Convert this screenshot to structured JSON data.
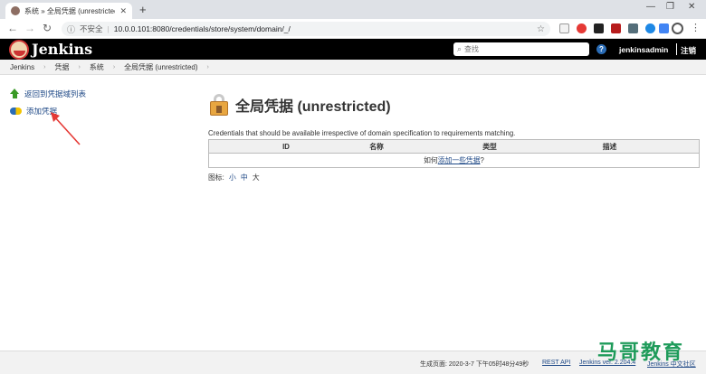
{
  "browser": {
    "tab_title": "系统 » 全局凭据 (unrestricted) [",
    "url_insecure": "不安全",
    "url": "10.0.0.101:8080/credentials/store/system/domain/_/"
  },
  "header": {
    "app_name": "Jenkins",
    "search_placeholder": "查找",
    "help": "?",
    "user": "jenkinsadmin",
    "logout": "注销"
  },
  "breadcrumb": [
    "Jenkins",
    "凭据",
    "系统",
    "全局凭据 (unrestricted)"
  ],
  "sidebar": {
    "items": [
      {
        "label": "返回到凭据域列表",
        "icon": "up-arrow-icon"
      },
      {
        "label": "添加凭据",
        "icon": "credentials-icon"
      }
    ]
  },
  "main": {
    "title": "全局凭据 (unrestricted)",
    "description": "Credentials that should be available irrespective of domain specification to requirements matching.",
    "table": {
      "columns": [
        "ID",
        "名称",
        "类型",
        "描述"
      ],
      "empty_prefix": "如何",
      "empty_link": "添加一些凭据",
      "empty_suffix": "?"
    },
    "icon_size": {
      "label": "图标:",
      "options": [
        "小",
        "中",
        "大"
      ]
    }
  },
  "footer": {
    "generated": "生成页面: 2020-3-7 下午05时48分49秒",
    "rest_api": "REST API",
    "version": "Jenkins ver. 2.204.4",
    "community": "Jenkins 中文社区"
  },
  "watermark": "马哥教育",
  "colors": {
    "header_bg": "#000000",
    "link": "#204a87",
    "annotation_arrow": "#e53935",
    "watermark": "#1e9b5a"
  }
}
